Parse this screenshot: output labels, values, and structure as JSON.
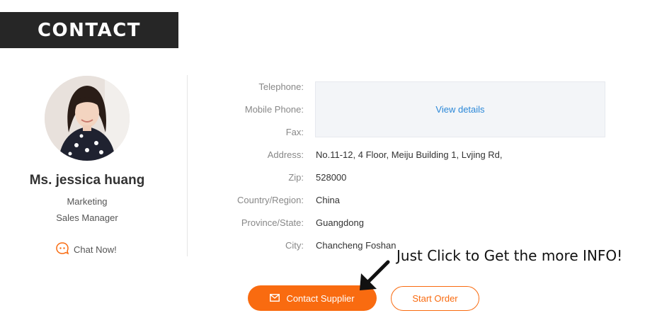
{
  "banner": {
    "title": "CONTACT"
  },
  "profile": {
    "name": "Ms. jessica huang",
    "department": "Marketing",
    "position": "Sales Manager",
    "chat_label": "Chat Now!"
  },
  "contact": {
    "telephone_label": "Telephone:",
    "mobile_label": "Mobile Phone:",
    "fax_label": "Fax:",
    "view_details": "View details",
    "address_label": "Address:",
    "address_value": "No.11-12, 4 Floor, Meiju Building 1, Lvjing Rd,",
    "zip_label": "Zip:",
    "zip_value": "528000",
    "country_label": "Country/Region:",
    "country_value": "China",
    "province_label": "Province/State:",
    "province_value": "Guangdong",
    "city_label": "City:",
    "city_value": "Chancheng Foshan"
  },
  "actions": {
    "contact_supplier": "Contact Supplier",
    "start_order": "Start Order"
  },
  "annotation": {
    "text": "Just Click to Get the more INFO!"
  },
  "colors": {
    "accent": "#f96b10",
    "link": "#2b88d8",
    "banner_bg": "#262626"
  },
  "icons": {
    "chat": "chat-bubble-icon",
    "mail": "mail-icon",
    "arrow": "arrow-down-left-icon"
  }
}
